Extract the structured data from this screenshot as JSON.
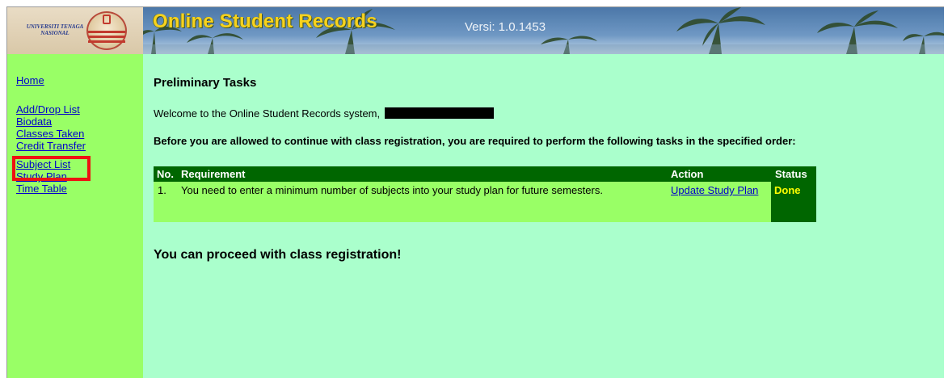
{
  "header": {
    "logo_text": "UNIVERSITI TENAGA NASIONAL",
    "title": "Online Student Records",
    "version": "Versi: 1.0.1453"
  },
  "sidebar": {
    "items": [
      {
        "label": "Home"
      },
      {
        "label": "Add/Drop List"
      },
      {
        "label": "Biodata"
      },
      {
        "label": "Classes Taken"
      },
      {
        "label": "Credit Transfer"
      },
      {
        "label": "Subject List"
      },
      {
        "label": "Study Plan"
      },
      {
        "label": "Time Table"
      }
    ]
  },
  "main": {
    "page_title": "Preliminary Tasks",
    "welcome": "Welcome to the Online Student Records system,",
    "instruction": "Before you are allowed to continue with class registration, you are required to perform the following tasks in the specified order:",
    "table": {
      "headers": {
        "no": "No.",
        "requirement": "Requirement",
        "action": "Action",
        "status": "Status"
      },
      "rows": [
        {
          "no": "1.",
          "requirement": "You need to enter a minimum number of subjects into your study plan for future semesters.",
          "action": "Update Study Plan",
          "status": "Done"
        }
      ]
    },
    "proceed": "You can proceed with class registration!"
  },
  "colors": {
    "sidebar_bg": "#99ff66",
    "main_bg": "#aaffcc",
    "table_header_bg": "#006600",
    "status_text": "#ffff00",
    "title_text": "#f7d21e",
    "highlight": "#ee1111"
  }
}
